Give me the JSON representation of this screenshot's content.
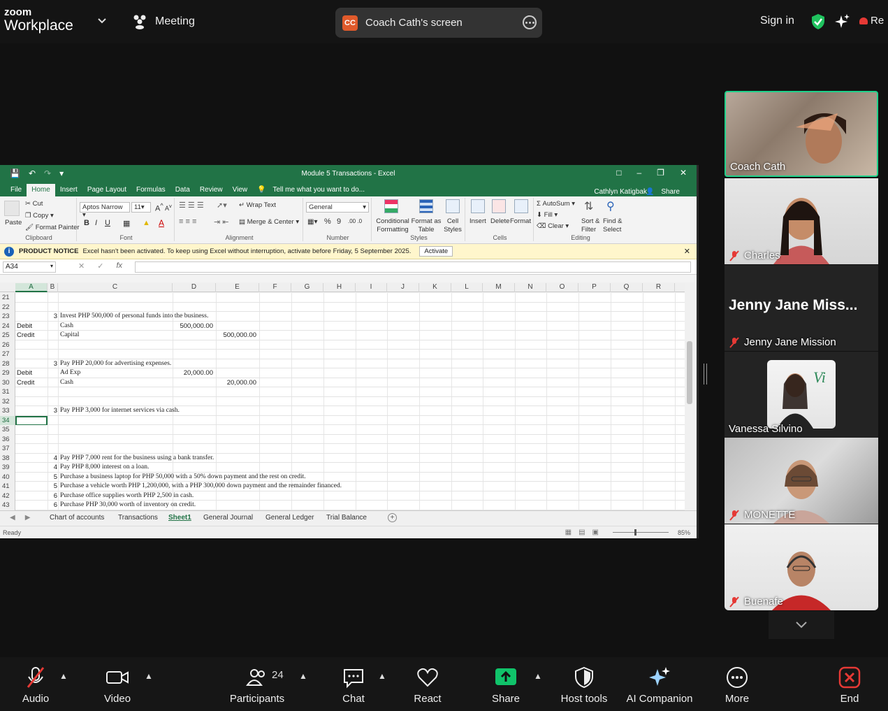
{
  "topbar": {
    "logo_top": "zoom",
    "logo_bottom": "Workplace",
    "meeting_label": "Meeting",
    "share_avatar": "CC",
    "share_title": "Coach Cath's screen",
    "sign_in": "Sign in",
    "record_label": "Re",
    "colors": {
      "accent_green": "#1fd28b",
      "avatar_orange": "#e05a2b"
    }
  },
  "excel": {
    "title": "Module 5 Transactions - Excel",
    "tabs": [
      "File",
      "Home",
      "Insert",
      "Page Layout",
      "Formulas",
      "Data",
      "Review",
      "View"
    ],
    "active_tab": "Home",
    "tell_me": "Tell me what you want to do...",
    "user": "Cathlyn Katigbak",
    "share": "Share",
    "ribbon": {
      "clipboard": {
        "paste": "Paste",
        "cut": "Cut",
        "copy": "Copy",
        "format_painter": "Format Painter",
        "label": "Clipboard"
      },
      "font": {
        "name": "Aptos Narrow",
        "size": "11",
        "label": "Font",
        "bold": "B",
        "italic": "I",
        "underline": "U"
      },
      "alignment": {
        "wrap": "Wrap Text",
        "merge": "Merge & Center",
        "label": "Alignment"
      },
      "number": {
        "format": "General",
        "label": "Number",
        "percent": "%",
        "comma": "9"
      },
      "styles": {
        "conditional": "Conditional Formatting",
        "format_table": "Format as Table",
        "cell_styles": "Cell Styles",
        "label": "Styles"
      },
      "cells": {
        "insert": "Insert",
        "delete": "Delete",
        "format": "Format",
        "label": "Cells"
      },
      "editing": {
        "autosum": "AutoSum",
        "fill": "Fill",
        "clear": "Clear",
        "sort": "Sort & Filter",
        "find": "Find & Select",
        "label": "Editing"
      }
    },
    "notice": {
      "heading": "PRODUCT NOTICE",
      "message": "Excel hasn't been activated. To keep using Excel without interruption, activate before Friday, 5 September 2025.",
      "button": "Activate"
    },
    "name_box": "A34",
    "fx": "fx",
    "columns": [
      "A",
      "B",
      "C",
      "D",
      "E",
      "F",
      "G",
      "H",
      "I",
      "J",
      "K",
      "L",
      "M",
      "N",
      "O",
      "P",
      "Q",
      "R"
    ],
    "rows": [
      {
        "n": "21",
        "a": "",
        "b": "",
        "c": "",
        "d": "",
        "e": ""
      },
      {
        "n": "22",
        "a": "",
        "b": "",
        "c": "",
        "d": "",
        "e": ""
      },
      {
        "n": "23",
        "a": "",
        "b": "3",
        "c": "Invest PHP 500,000 of personal funds into the business.",
        "d": "",
        "e": ""
      },
      {
        "n": "24",
        "a": "Debit",
        "b": "",
        "c": "Cash",
        "d": "500,000.00",
        "e": ""
      },
      {
        "n": "25",
        "a": "Credit",
        "b": "",
        "c": "Capital",
        "d": "",
        "e": "500,000.00"
      },
      {
        "n": "26",
        "a": "",
        "b": "",
        "c": "",
        "d": "",
        "e": ""
      },
      {
        "n": "27",
        "a": "",
        "b": "",
        "c": "",
        "d": "",
        "e": ""
      },
      {
        "n": "28",
        "a": "",
        "b": "3",
        "c": "Pay PHP 20,000 for advertising expenses.",
        "d": "",
        "e": ""
      },
      {
        "n": "29",
        "a": "Debit",
        "b": "",
        "c": "Ad Exp",
        "d": "20,000.00",
        "e": ""
      },
      {
        "n": "30",
        "a": "Credit",
        "b": "",
        "c": "Cash",
        "d": "",
        "e": "20,000.00"
      },
      {
        "n": "31",
        "a": "",
        "b": "",
        "c": "",
        "d": "",
        "e": ""
      },
      {
        "n": "32",
        "a": "",
        "b": "",
        "c": "",
        "d": "",
        "e": ""
      },
      {
        "n": "33",
        "a": "",
        "b": "3",
        "c": "Pay PHP 3,000 for internet services via cash.",
        "d": "",
        "e": ""
      },
      {
        "n": "34",
        "a": "",
        "b": "",
        "c": "",
        "d": "",
        "e": ""
      },
      {
        "n": "35",
        "a": "",
        "b": "",
        "c": "",
        "d": "",
        "e": ""
      },
      {
        "n": "36",
        "a": "",
        "b": "",
        "c": "",
        "d": "",
        "e": ""
      },
      {
        "n": "37",
        "a": "",
        "b": "",
        "c": "",
        "d": "",
        "e": ""
      },
      {
        "n": "38",
        "a": "",
        "b": "4",
        "c": "Pay PHP 7,000 rent for the business using a bank transfer.",
        "d": "",
        "e": ""
      },
      {
        "n": "39",
        "a": "",
        "b": "4",
        "c": "Pay PHP 8,000 interest on a loan.",
        "d": "",
        "e": ""
      },
      {
        "n": "40",
        "a": "",
        "b": "5",
        "c": "Purchase a business laptop for PHP 50,000 with a 50% down payment and the rest on credit.",
        "d": "",
        "e": ""
      },
      {
        "n": "41",
        "a": "",
        "b": "5",
        "c": "Purchase a vehicle worth PHP 1,200,000, with a PHP 300,000 down payment and the remainder financed.",
        "d": "",
        "e": ""
      },
      {
        "n": "42",
        "a": "",
        "b": "6",
        "c": "Purchase office supplies worth PHP 2,500 in cash.",
        "d": "",
        "e": ""
      },
      {
        "n": "43",
        "a": "",
        "b": "6",
        "c": "Purchase PHP 30,000 worth of inventory on credit.",
        "d": "",
        "e": ""
      }
    ],
    "sheets": [
      "Chart of accounts",
      "Transactions",
      "Sheet1",
      "General Journal",
      "General Ledger",
      "Trial Balance"
    ],
    "active_sheet": "Sheet1",
    "status": "Ready",
    "zoom": "85%"
  },
  "participants": [
    {
      "name": "Coach Cath",
      "muted": false,
      "active": true
    },
    {
      "name": "Charles",
      "muted": true
    },
    {
      "name": "Jenny Jane Mission",
      "muted": true,
      "big_label": "Jenny Jane Miss..."
    },
    {
      "name": "Vanessa Silvino",
      "muted": false
    },
    {
      "name": "MONETTE",
      "muted": true
    },
    {
      "name": "Buenafe",
      "muted": true
    }
  ],
  "toolbar": {
    "audio": "Audio",
    "video": "Video",
    "participants": "Participants",
    "participant_count": "24",
    "chat": "Chat",
    "react": "React",
    "share": "Share",
    "host_tools": "Host tools",
    "ai_companion": "AI Companion",
    "more": "More",
    "end": "End"
  }
}
